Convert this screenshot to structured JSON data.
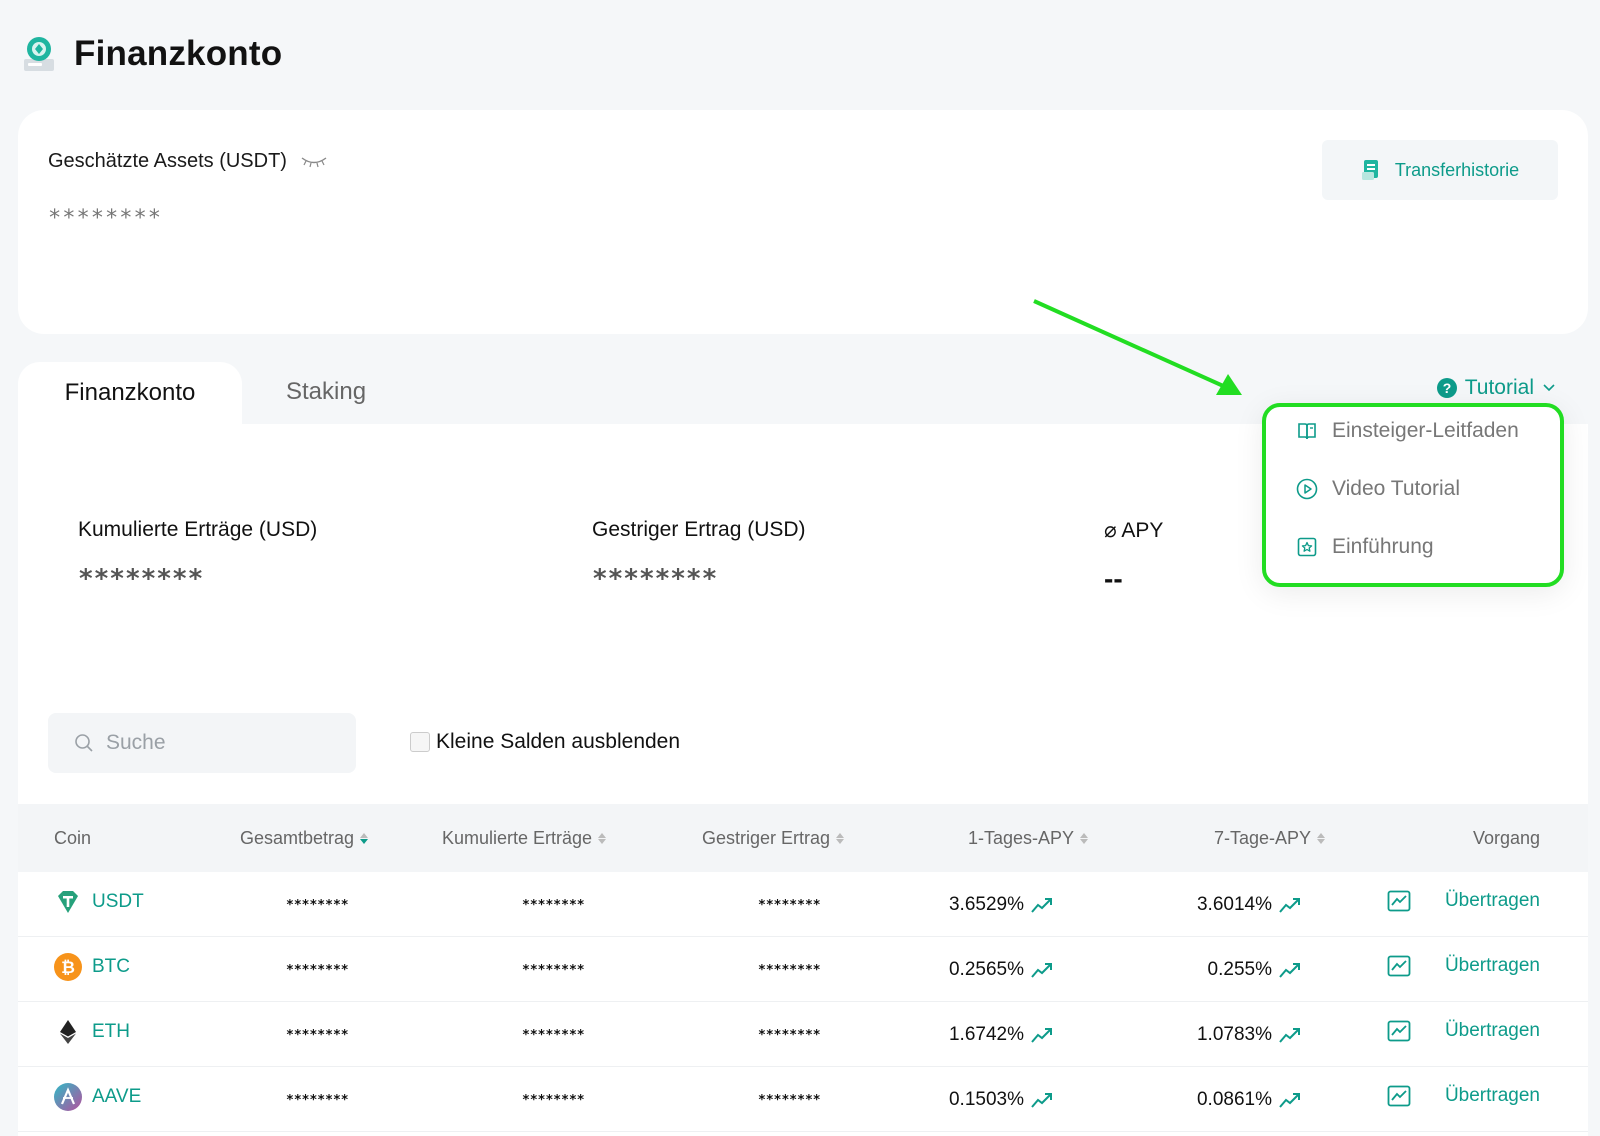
{
  "header": {
    "title": "Finanzkonto"
  },
  "assets": {
    "label": "Geschätzte Assets (USDT)",
    "value": "********",
    "transfer_label": "Transferhistorie"
  },
  "tabs": [
    {
      "label": "Finanzkonto",
      "active": true
    },
    {
      "label": "Staking",
      "active": false
    }
  ],
  "tutorial": {
    "label": "Tutorial",
    "items": [
      {
        "label": "Einsteiger-Leitfaden",
        "icon": "book-icon"
      },
      {
        "label": "Video Tutorial",
        "icon": "play-circle-icon"
      },
      {
        "label": "Einführung",
        "icon": "star-badge-icon"
      }
    ]
  },
  "stats": {
    "cumulative": {
      "label": "Kumulierte Erträge (USD)",
      "value": "********"
    },
    "yesterday": {
      "label": "Gestriger Ertrag (USD)",
      "value": "********"
    },
    "apy": {
      "label": "⌀ APY",
      "value": "--"
    }
  },
  "search": {
    "placeholder": "Suche"
  },
  "hide_small": {
    "label": "Kleine Salden ausblenden",
    "checked": false
  },
  "table": {
    "headers": {
      "coin": "Coin",
      "total": "Gesamtbetrag",
      "cumulative": "Kumulierte Erträge",
      "yesterday": "Gestriger Ertrag",
      "apy1": "1-Tages-APY",
      "apy7": "7-Tage-APY",
      "action": "Vorgang"
    },
    "rows": [
      {
        "coin": "USDT",
        "total": "********",
        "cumulative": "********",
        "yesterday": "********",
        "apy1": "3.6529%",
        "apy7": "3.6014%",
        "action": "Übertragen"
      },
      {
        "coin": "BTC",
        "total": "********",
        "cumulative": "********",
        "yesterday": "********",
        "apy1": "0.2565%",
        "apy7": "0.255%",
        "action": "Übertragen"
      },
      {
        "coin": "ETH",
        "total": "********",
        "cumulative": "********",
        "yesterday": "********",
        "apy1": "1.6742%",
        "apy7": "1.0783%",
        "action": "Übertragen"
      },
      {
        "coin": "AAVE",
        "total": "********",
        "cumulative": "********",
        "yesterday": "********",
        "apy1": "0.1503%",
        "apy7": "0.0861%",
        "action": "Übertragen"
      }
    ]
  },
  "colors": {
    "accent": "#0d9b8a",
    "highlight": "#22dd22",
    "usdt": "#26a17b",
    "btc": "#f7931a",
    "eth": "#222222",
    "aave": "#6a5acd"
  }
}
